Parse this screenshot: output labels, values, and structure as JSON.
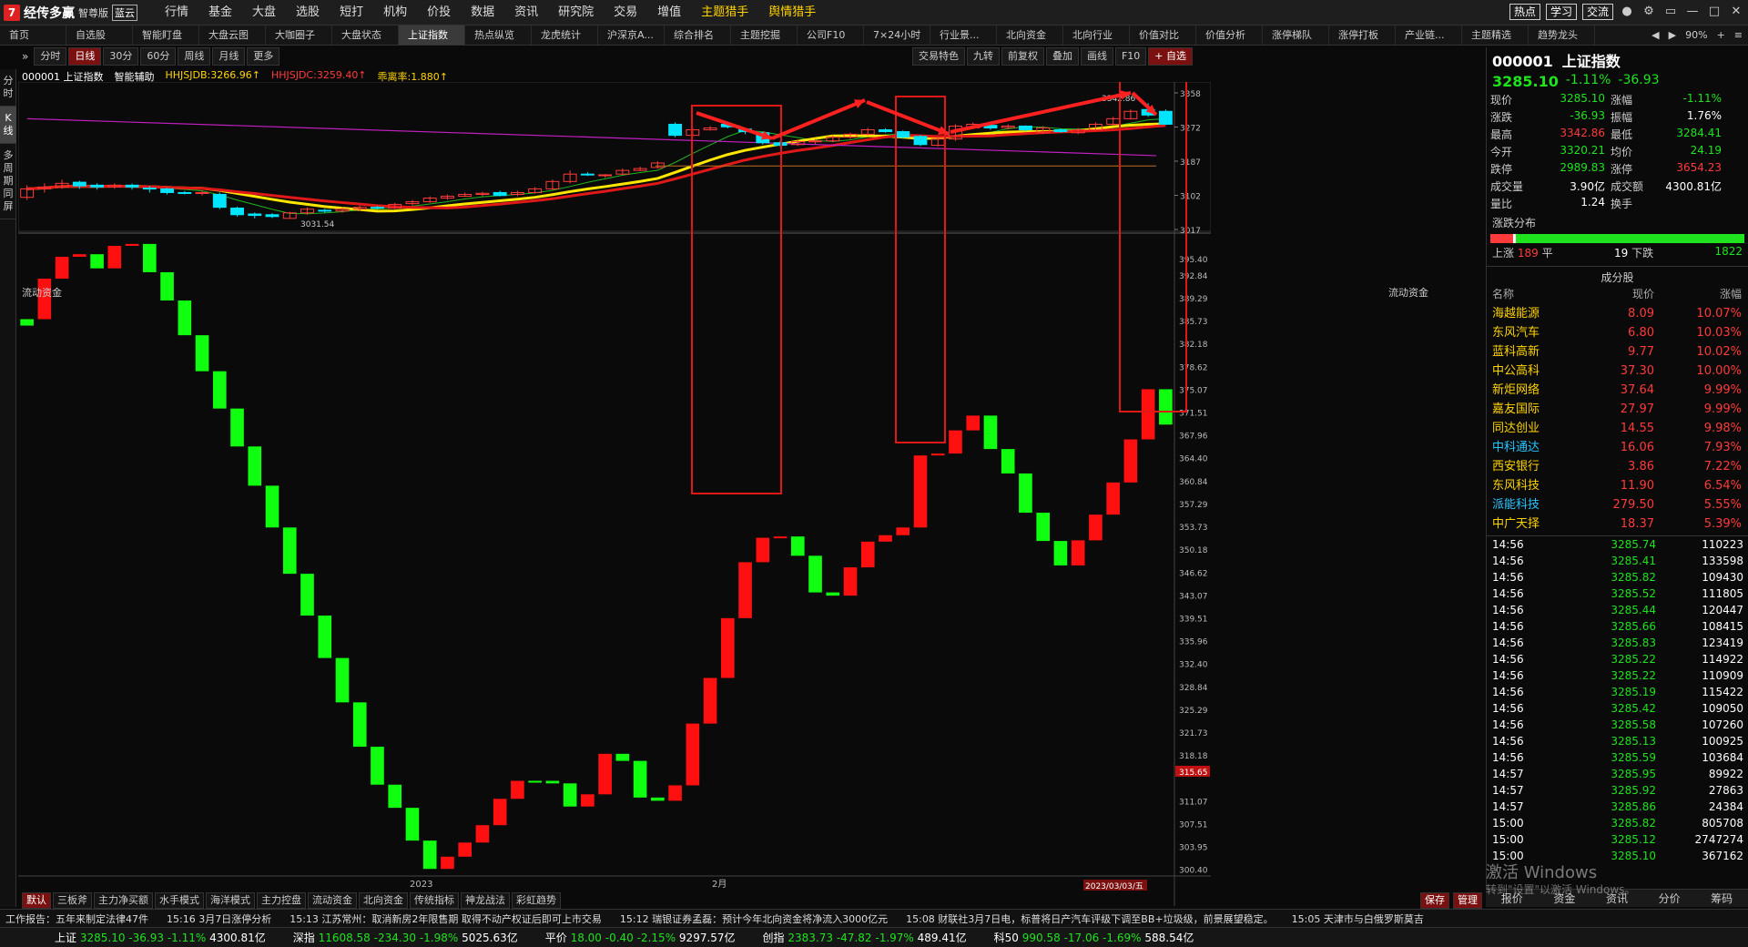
{
  "app": {
    "name": "经传多赢",
    "edition": "智尊版",
    "badge": "蓝云"
  },
  "menu": [
    {
      "label": "行情",
      "hot": false,
      "dot": false
    },
    {
      "label": "基金",
      "hot": false,
      "dot": false
    },
    {
      "label": "大盘",
      "hot": false,
      "dot": true
    },
    {
      "label": "选股",
      "hot": false,
      "dot": true
    },
    {
      "label": "短打",
      "hot": false,
      "dot": false
    },
    {
      "label": "机构",
      "hot": false,
      "dot": false
    },
    {
      "label": "价投",
      "hot": false,
      "dot": true
    },
    {
      "label": "数据",
      "hot": false,
      "dot": false
    },
    {
      "label": "资讯",
      "hot": false,
      "dot": false
    },
    {
      "label": "研究院",
      "hot": false,
      "dot": false
    },
    {
      "label": "交易",
      "hot": false,
      "dot": false
    },
    {
      "label": "增值",
      "hot": false,
      "dot": true
    },
    {
      "label": "主题猎手",
      "hot": true,
      "dot": true
    },
    {
      "label": "舆情猎手",
      "hot": true,
      "dot": true
    }
  ],
  "topright": {
    "tags": [
      "热点",
      "学习",
      "交流"
    ]
  },
  "tabs": [
    {
      "label": "首页",
      "active": false
    },
    {
      "label": "自选股",
      "active": false
    },
    {
      "label": "智能盯盘",
      "active": false
    },
    {
      "label": "大盘云图",
      "active": false
    },
    {
      "label": "大咖圈子",
      "active": false
    },
    {
      "label": "大盘状态",
      "active": false
    },
    {
      "label": "上证指数",
      "active": true
    },
    {
      "label": "热点纵览",
      "active": false
    },
    {
      "label": "龙虎统计",
      "active": false
    },
    {
      "label": "沪深京A...",
      "active": false
    },
    {
      "label": "综合排名",
      "active": false
    },
    {
      "label": "主题挖掘",
      "active": false
    },
    {
      "label": "公司F10",
      "active": false
    },
    {
      "label": "7×24小时",
      "active": false
    },
    {
      "label": "行业景...",
      "active": false
    },
    {
      "label": "北向资金",
      "active": false
    },
    {
      "label": "北向行业",
      "active": false
    },
    {
      "label": "价值对比",
      "active": false
    },
    {
      "label": "价值分析",
      "active": false
    },
    {
      "label": "涨停梯队",
      "active": false
    },
    {
      "label": "涨停打板",
      "active": false
    },
    {
      "label": "产业链...",
      "active": false
    },
    {
      "label": "主题精选",
      "active": false
    },
    {
      "label": "趋势龙头",
      "active": false
    }
  ],
  "tabbar_right": {
    "zoom": "90%"
  },
  "lefttabs": [
    {
      "label": "分时",
      "active": false
    },
    {
      "label": "K线",
      "active": true
    },
    {
      "label": "多周期同屏",
      "active": false
    }
  ],
  "periods": [
    {
      "label": "分时",
      "active": false
    },
    {
      "label": "日线",
      "active": true
    },
    {
      "label": "30分",
      "active": false
    },
    {
      "label": "60分",
      "active": false
    },
    {
      "label": "周线",
      "active": false
    },
    {
      "label": "月线",
      "active": false
    },
    {
      "label": "更多",
      "active": false
    }
  ],
  "period_right": [
    "交易特色",
    "九转",
    "前复权",
    "叠加",
    "画线",
    "F10",
    "+ 自选"
  ],
  "kheader": {
    "code": "000001 上证指数",
    "assist": "智能辅助",
    "l1": "HHJSJDB:3266.96↑",
    "l2": "HHJSJDC:3259.40↑",
    "l3": "乖离率:1.880↑"
  },
  "fund_title": "流动资金",
  "chart_data": [
    {
      "type": "candlestick",
      "title": "000001 上证指数",
      "x_labels": [
        "2023",
        "2月",
        "2023/03/03/五"
      ],
      "y_ticks": [
        "3358",
        "3272",
        "3187",
        "3102",
        "3017"
      ],
      "ylim": [
        3000,
        3370
      ],
      "low_label": "3031.54",
      "high_label": "3342.86",
      "colors": {
        "up": "#ff3a3a",
        "down": "#00e5ff",
        "ma_yellow": "#ffe600",
        "ma_red": "#e01818",
        "ma_green": "#1fb51f",
        "ma_purple": "#c020c0",
        "ma_orange": "#c07020"
      },
      "candles": [
        [
          3087,
          3110,
          3080,
          3120
        ],
        [
          3110,
          3115,
          3100,
          3125
        ],
        [
          3115,
          3125,
          3110,
          3135
        ],
        [
          3128,
          3118,
          3110,
          3132
        ],
        [
          3120,
          3115,
          3108,
          3125
        ],
        [
          3115,
          3120,
          3110,
          3125
        ],
        [
          3120,
          3115,
          3108,
          3124
        ],
        [
          3112,
          3110,
          3100,
          3118
        ],
        [
          3110,
          3100,
          3095,
          3113
        ],
        [
          3100,
          3098,
          3095,
          3104
        ],
        [
          3098,
          3100,
          3092,
          3105
        ],
        [
          3095,
          3060,
          3055,
          3100
        ],
        [
          3058,
          3040,
          3035,
          3062
        ],
        [
          3042,
          3038,
          3030,
          3046
        ],
        [
          3040,
          3035,
          3031,
          3044
        ],
        [
          3030,
          3045,
          3031,
          3048
        ],
        [
          3045,
          3055,
          3040,
          3060
        ],
        [
          3052,
          3050,
          3045,
          3056
        ],
        [
          3050,
          3055,
          3045,
          3060
        ],
        [
          3055,
          3060,
          3050,
          3065
        ],
        [
          3060,
          3058,
          3054,
          3064
        ],
        [
          3058,
          3068,
          3055,
          3072
        ],
        [
          3070,
          3075,
          3065,
          3080
        ],
        [
          3075,
          3085,
          3072,
          3090
        ],
        [
          3085,
          3090,
          3080,
          3095
        ],
        [
          3090,
          3095,
          3088,
          3100
        ],
        [
          3095,
          3098,
          3090,
          3102
        ],
        [
          3100,
          3092,
          3090,
          3105
        ],
        [
          3095,
          3100,
          3090,
          3105
        ],
        [
          3100,
          3110,
          3098,
          3115
        ],
        [
          3110,
          3130,
          3108,
          3135
        ],
        [
          3130,
          3150,
          3125,
          3160
        ],
        [
          3150,
          3148,
          3145,
          3155
        ],
        [
          3148,
          3148,
          3140,
          3150
        ],
        [
          3150,
          3160,
          3148,
          3165
        ],
        [
          3160,
          3165,
          3158,
          3170
        ],
        [
          3168,
          3180,
          3165,
          3185
        ],
        [
          3285,
          3255,
          3250,
          3290
        ],
        [
          3255,
          3270,
          3252,
          3275
        ],
        [
          3270,
          3275,
          3268,
          3280
        ],
        [
          3285,
          3278,
          3274,
          3288
        ],
        [
          3272,
          3265,
          3258,
          3275
        ],
        [
          3262,
          3235,
          3230,
          3265
        ],
        [
          3235,
          3228,
          3225,
          3240
        ],
        [
          3230,
          3238,
          3226,
          3242
        ],
        [
          3238,
          3240,
          3232,
          3245
        ],
        [
          3240,
          3250,
          3236,
          3255
        ],
        [
          3250,
          3258,
          3245,
          3262
        ],
        [
          3258,
          3270,
          3255,
          3275
        ],
        [
          3270,
          3265,
          3262,
          3274
        ],
        [
          3265,
          3250,
          3246,
          3268
        ],
        [
          3252,
          3230,
          3226,
          3256
        ],
        [
          3228,
          3245,
          3225,
          3250
        ],
        [
          3245,
          3280,
          3240,
          3285
        ],
        [
          3275,
          3285,
          3272,
          3290
        ],
        [
          3282,
          3275,
          3270,
          3288
        ],
        [
          3276,
          3280,
          3272,
          3285
        ],
        [
          3280,
          3270,
          3265,
          3282
        ],
        [
          3262,
          3275,
          3258,
          3280
        ],
        [
          3270,
          3265,
          3262,
          3274
        ],
        [
          3262,
          3270,
          3258,
          3275
        ],
        [
          3270,
          3285,
          3268,
          3290
        ],
        [
          3285,
          3300,
          3282,
          3305
        ],
        [
          3300,
          3320,
          3298,
          3325
        ],
        [
          3325,
          3310,
          3305,
          3342
        ],
        [
          3320,
          3285,
          3284,
          3325
        ]
      ],
      "annotations": [
        {
          "type": "rect"
        },
        {
          "type": "rect"
        },
        {
          "type": "rect"
        },
        {
          "type": "arrow"
        },
        {
          "type": "arrow"
        },
        {
          "type": "arrow"
        },
        {
          "type": "arrow"
        },
        {
          "type": "arrow"
        }
      ]
    },
    {
      "type": "bar",
      "title": "流动资金",
      "y_ticks": [
        "395.40",
        "392.84",
        "389.29",
        "385.73",
        "382.18",
        "378.62",
        "375.07",
        "371.51",
        "367.96",
        "364.40",
        "360.84",
        "357.29",
        "353.73",
        "350.18",
        "346.62",
        "343.07",
        "339.51",
        "335.96",
        "332.40",
        "328.84",
        "325.29",
        "321.73",
        "318.18",
        "315.65",
        "311.07",
        "307.51",
        "303.95",
        "300.40"
      ],
      "ylim": [
        299.5,
        397.5
      ],
      "current_label": "315.65",
      "x_labels": [
        "2023",
        "2月"
      ],
      "bars": [
        [
          386.1,
          385.1
        ],
        [
          386.1,
          392.4
        ],
        [
          392.4,
          395.8
        ],
        [
          395.8,
          396.2
        ],
        [
          396.2,
          394.0
        ],
        [
          394.0,
          397.5
        ],
        [
          397.5,
          397.8
        ],
        [
          397.8,
          393.4
        ],
        [
          393.4,
          389.0
        ],
        [
          389.0,
          383.6
        ],
        [
          383.6,
          378.0
        ],
        [
          378.0,
          372.2
        ],
        [
          372.2,
          366.3
        ],
        [
          366.3,
          360.2
        ],
        [
          360.2,
          353.7
        ],
        [
          353.7,
          346.5
        ],
        [
          346.5,
          340.0
        ],
        [
          340.0,
          333.4
        ],
        [
          333.4,
          326.5
        ],
        [
          326.5,
          319.6
        ],
        [
          319.6,
          313.7
        ],
        [
          313.7,
          310.1
        ],
        [
          310.1,
          305.0
        ],
        [
          305.0,
          300.6
        ],
        [
          300.6,
          302.5
        ],
        [
          302.5,
          304.7
        ],
        [
          304.7,
          307.4
        ],
        [
          307.4,
          311.5
        ],
        [
          311.5,
          314.3
        ],
        [
          314.3,
          314.3
        ],
        [
          314.3,
          313.9
        ],
        [
          313.9,
          310.3
        ],
        [
          310.3,
          312.2
        ],
        [
          312.2,
          318.5
        ],
        [
          318.5,
          317.4
        ],
        [
          317.4,
          311.7
        ],
        [
          311.7,
          311.2
        ],
        [
          311.2,
          313.6
        ],
        [
          313.6,
          323.2
        ],
        [
          323.2,
          330.3
        ],
        [
          330.3,
          339.6
        ],
        [
          339.6,
          348.3
        ],
        [
          348.3,
          352.1
        ],
        [
          352.1,
          352.3
        ],
        [
          352.3,
          349.3
        ],
        [
          349.3,
          343.6
        ],
        [
          343.6,
          343.1
        ],
        [
          343.1,
          347.5
        ],
        [
          347.5,
          351.5
        ],
        [
          351.5,
          352.5
        ],
        [
          352.5,
          353.7
        ],
        [
          353.7,
          364.9
        ],
        [
          364.9,
          365.2
        ],
        [
          365.2,
          368.8
        ],
        [
          368.8,
          371.1
        ],
        [
          371.1,
          365.9
        ],
        [
          365.9,
          362.1
        ],
        [
          362.1,
          356.0
        ],
        [
          356.0,
          351.6
        ],
        [
          351.6,
          347.8
        ],
        [
          347.8,
          351.7
        ],
        [
          351.7,
          355.7
        ],
        [
          355.7,
          360.7
        ],
        [
          360.7,
          367.4
        ],
        [
          367.4,
          375.2
        ],
        [
          375.2,
          369.7
        ]
      ]
    }
  ],
  "right_panel": {
    "code": "000001",
    "name": "上证指数",
    "price": "3285.10",
    "pct": "-1.11%",
    "chg": "-36.93",
    "quotes": [
      [
        "现价",
        "3285.10",
        "dn",
        "涨幅",
        "-1.11%",
        "dn"
      ],
      [
        "涨跌",
        "-36.93",
        "dn",
        "振幅",
        "1.76%",
        "wh"
      ],
      [
        "最高",
        "3342.86",
        "up",
        "最低",
        "3284.41",
        "dn"
      ],
      [
        "今开",
        "3320.21",
        "dn",
        "均价",
        "24.19",
        "dn"
      ],
      [
        "跌停",
        "2989.83",
        "dn",
        "涨停",
        "3654.23",
        "up"
      ],
      [
        "成交量",
        "3.90亿",
        "wh",
        "成交额",
        "4300.81亿",
        "wh"
      ],
      [
        "量比",
        "1.24",
        "wh",
        "换手",
        "",
        ""
      ]
    ],
    "dist_label": "涨跌分布",
    "up_label": "上涨",
    "up": "189",
    "flat_label": "平",
    "flat": "19",
    "down_label": "下跌",
    "down": "1822",
    "cons_title": "成分股",
    "cons_headers": [
      "名称",
      "现价",
      "涨幅"
    ],
    "constituents": [
      [
        "海越能源",
        "8.09",
        "10.07%",
        "yl"
      ],
      [
        "东风汽车",
        "6.80",
        "10.03%",
        "yl"
      ],
      [
        "蓝科高新",
        "9.77",
        "10.02%",
        "yl"
      ],
      [
        "中公高科",
        "37.30",
        "10.00%",
        "yl"
      ],
      [
        "新炬网络",
        "37.64",
        "9.99%",
        "yl"
      ],
      [
        "嘉友国际",
        "27.97",
        "9.99%",
        "yl"
      ],
      [
        "同达创业",
        "14.55",
        "9.98%",
        "yl"
      ],
      [
        "中科通达",
        "16.06",
        "7.93%",
        "cy"
      ],
      [
        "西安银行",
        "3.86",
        "7.22%",
        "yl"
      ],
      [
        "东风科技",
        "11.90",
        "6.54%",
        "yl"
      ],
      [
        "派能科技",
        "279.50",
        "5.55%",
        "cy"
      ],
      [
        "中广天择",
        "18.37",
        "5.39%",
        "yl"
      ]
    ],
    "ticks": [
      [
        "14:56",
        "3285.74",
        "110223"
      ],
      [
        "14:56",
        "3285.41",
        "133598"
      ],
      [
        "14:56",
        "3285.82",
        "109430"
      ],
      [
        "14:56",
        "3285.52",
        "111805"
      ],
      [
        "14:56",
        "3285.44",
        "120447"
      ],
      [
        "14:56",
        "3285.66",
        "108415"
      ],
      [
        "14:56",
        "3285.83",
        "123419"
      ],
      [
        "14:56",
        "3285.22",
        "114922"
      ],
      [
        "14:56",
        "3285.22",
        "110909"
      ],
      [
        "14:56",
        "3285.19",
        "115422"
      ],
      [
        "14:56",
        "3285.42",
        "109050"
      ],
      [
        "14:56",
        "3285.58",
        "107260"
      ],
      [
        "14:56",
        "3285.13",
        "100925"
      ],
      [
        "14:56",
        "3285.59",
        "103684"
      ],
      [
        "14:57",
        "3285.95",
        "89922"
      ],
      [
        "14:57",
        "3285.92",
        "27863"
      ],
      [
        "14:57",
        "3285.86",
        "24384"
      ],
      [
        "15:00",
        "3285.82",
        "805708"
      ],
      [
        "15:00",
        "3285.12",
        "2747274"
      ],
      [
        "15:00",
        "3285.10",
        "367162"
      ]
    ],
    "bottom": [
      "报价",
      "资金",
      "资讯",
      "分价",
      "筹码"
    ]
  },
  "bottom_tabs": [
    {
      "label": "默认",
      "active": true
    },
    {
      "label": "三板斧",
      "active": false
    },
    {
      "label": "主力净买额",
      "active": false
    },
    {
      "label": "水手模式",
      "active": false
    },
    {
      "label": "海洋模式",
      "active": false
    },
    {
      "label": "主力控盘",
      "active": false
    },
    {
      "label": "流动资金",
      "active": false
    },
    {
      "label": "北向资金",
      "active": false
    },
    {
      "label": "传统指标",
      "active": false
    },
    {
      "label": "神龙战法",
      "active": false
    },
    {
      "label": "彩虹趋势",
      "active": false
    }
  ],
  "bottom_right": [
    "保存",
    "管理"
  ],
  "news": [
    "工作报告：五年来制定法律47件",
    "15:16 3月7日涨停分析",
    "15:13 江苏常州：取消新房2年限售期 取得不动产权证后即可上市交易",
    "15:12 瑞银证券孟磊：预计今年北向资金将净流入3000亿元",
    "15:08 财联社3月7日电，标普将日产汽车评级下调至BB+垃圾级，前景展望稳定。",
    "15:05 天津市与白俄罗斯莫吉"
  ],
  "indices": [
    {
      "name": "上证",
      "price": "3285.10",
      "chg": "-36.93",
      "pct": "-1.11%",
      "amt": "4300.81亿"
    },
    {
      "name": "深指",
      "price": "11608.58",
      "chg": "-234.30",
      "pct": "-1.98%",
      "amt": "5025.63亿"
    },
    {
      "name": "平价",
      "price": "18.00",
      "chg": "-0.40",
      "pct": "-2.15%",
      "amt": "9297.57亿"
    },
    {
      "name": "创指",
      "price": "2383.73",
      "chg": "-47.82",
      "pct": "-1.97%",
      "amt": "489.41亿"
    },
    {
      "name": "科50",
      "price": "990.58",
      "chg": "-17.06",
      "pct": "-1.69%",
      "amt": "588.54亿"
    }
  ],
  "windows_watermark": {
    "line1": "激活 Windows",
    "line2": "转到\"设置\"以激活 Windows。"
  }
}
